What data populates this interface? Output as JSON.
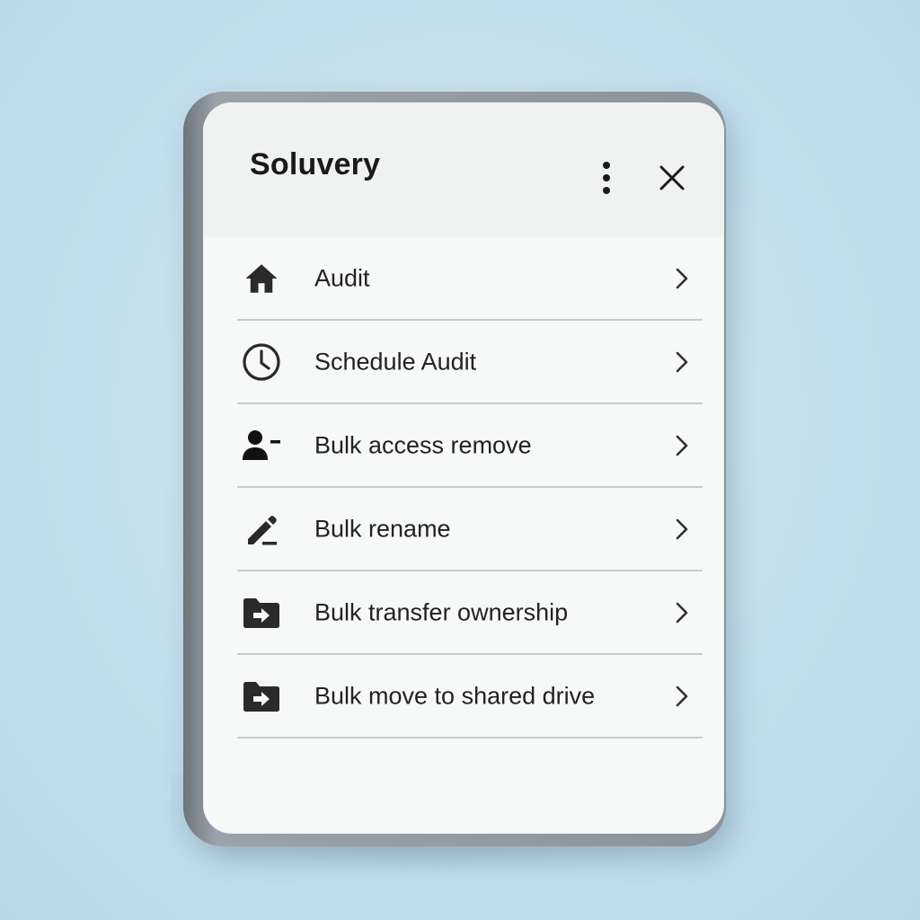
{
  "app": {
    "title": "Soluvery"
  },
  "header": {
    "more_icon": "more-vertical-icon",
    "close_icon": "close-icon"
  },
  "menu": {
    "items": [
      {
        "label": "Audit",
        "icon": "home-icon"
      },
      {
        "label": "Schedule Audit",
        "icon": "clock-icon"
      },
      {
        "label": "Bulk access remove",
        "icon": "person-remove-icon"
      },
      {
        "label": "Bulk rename",
        "icon": "pencil-icon"
      },
      {
        "label": "Bulk transfer ownership",
        "icon": "folder-arrow-icon"
      },
      {
        "label": "Bulk move to shared drive",
        "icon": "folder-arrow-icon"
      }
    ]
  },
  "colors": {
    "background": "#c4dfec",
    "frame": "#8b939b",
    "screen": "#f7f8f8",
    "text": "#222222",
    "divider": "#c9cccd"
  }
}
